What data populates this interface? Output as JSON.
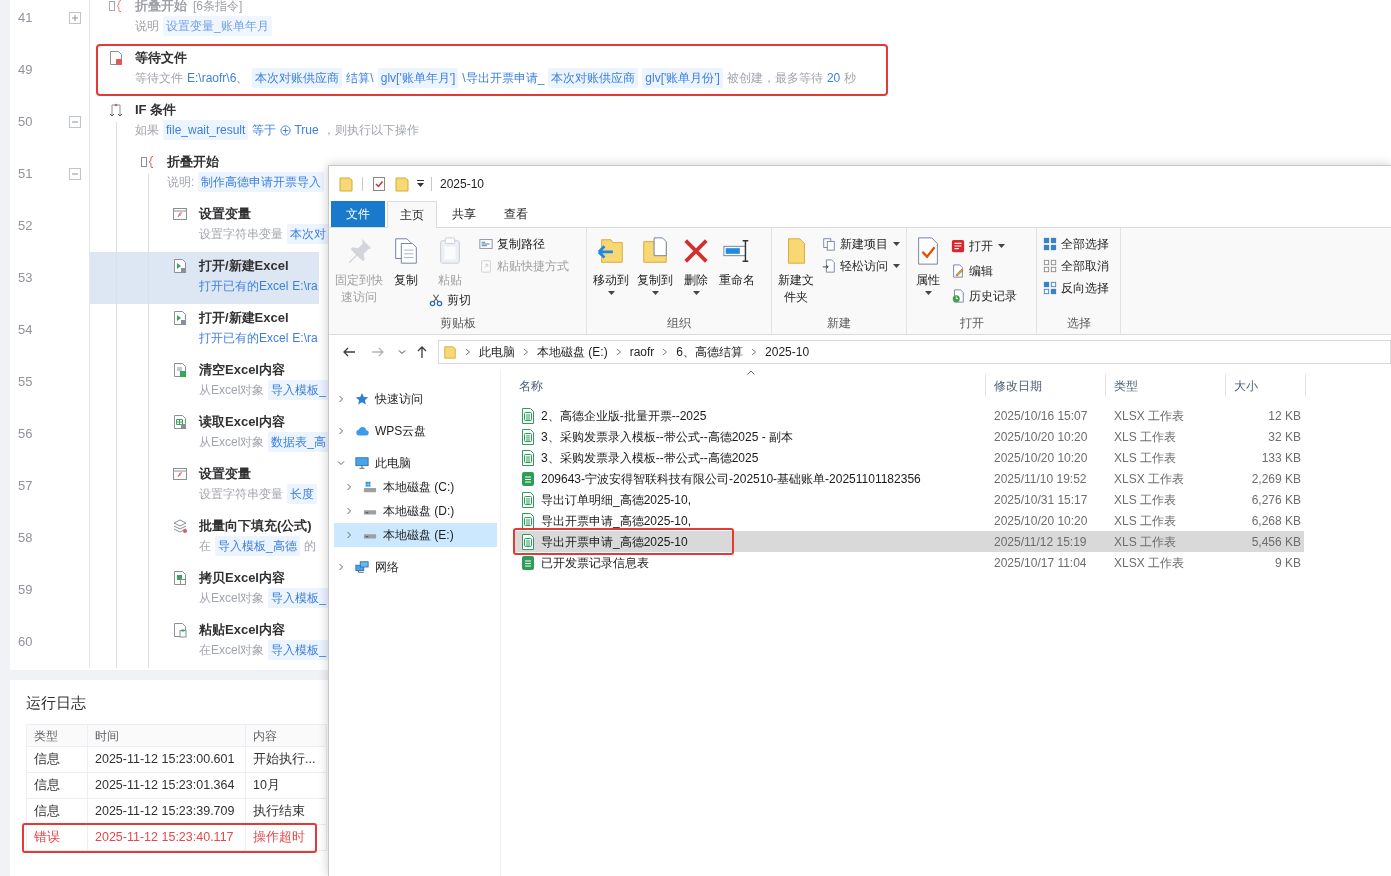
{
  "workflow": {
    "steps": [
      {
        "line": "41",
        "kind": "fold",
        "title": "折叠开始",
        "count": "[6条指令]",
        "disabled": true,
        "selected": false,
        "expanded": false,
        "description": [
          {
            "kind": "plain",
            "text": "说明"
          },
          {
            "kind": "chip",
            "text": "设置变量_账单年月"
          }
        ]
      },
      {
        "line": "49",
        "kind": "wait_file",
        "title": "等待文件",
        "disabled": false,
        "selected": false,
        "highlighted": true,
        "description": [
          {
            "kind": "plain",
            "text": "等待文件"
          },
          {
            "kind": "value",
            "text": "E:\\raofr\\6、"
          },
          {
            "kind": "chip",
            "text": "本次对账供应商"
          },
          {
            "kind": "value",
            "text": "结算\\"
          },
          {
            "kind": "chip",
            "text": "glv['账单年月']"
          },
          {
            "kind": "value",
            "text": "\\导出开票申请_"
          },
          {
            "kind": "chip",
            "text": "本次对账供应商"
          },
          {
            "kind": "chip",
            "text": "glv['账单月份']"
          },
          {
            "kind": "plain",
            "text": "被创建，最多等待"
          },
          {
            "kind": "value",
            "text": "20"
          },
          {
            "kind": "plain",
            "text": "秒"
          }
        ]
      },
      {
        "line": "50",
        "kind": "if",
        "title": "IF 条件",
        "disabled": false,
        "selected": false,
        "expanded": true,
        "description": [
          {
            "kind": "plain",
            "text": "如果"
          },
          {
            "kind": "chip",
            "text": "file_wait_result"
          },
          {
            "kind": "value",
            "text": "等于"
          },
          {
            "kind": "bool",
            "text": "True"
          },
          {
            "kind": "plain",
            "text": "，则执行以下操作"
          }
        ],
        "children": [
          {
            "line": "51",
            "kind": "fold",
            "title": "折叠开始",
            "disabled": false,
            "selected": false,
            "expanded": true,
            "description": [
              {
                "kind": "plain",
                "text": "说明:"
              },
              {
                "kind": "chip",
                "text": "制作高德申请开票导入"
              }
            ],
            "children": [
              {
                "line": "52",
                "kind": "set_variable",
                "title": "设置变量",
                "disabled": false,
                "selected": false,
                "description": [
                  {
                    "kind": "plain",
                    "text": "设置字符串变量"
                  },
                  {
                    "kind": "chip",
                    "text": "本次对"
                  }
                ]
              },
              {
                "line": "53",
                "kind": "open_excel",
                "title": "打开/新建Excel",
                "disabled": false,
                "selected": true,
                "description": [
                  {
                    "kind": "value",
                    "text": "打开已有的Excel"
                  },
                  {
                    "kind": "value",
                    "text": "E:\\ra"
                  }
                ]
              },
              {
                "line": "54",
                "kind": "open_excel",
                "title": "打开/新建Excel",
                "disabled": false,
                "selected": false,
                "description": [
                  {
                    "kind": "value",
                    "text": "打开已有的Excel"
                  },
                  {
                    "kind": "value",
                    "text": "E:\\ra"
                  }
                ]
              },
              {
                "line": "55",
                "kind": "clear_excel",
                "title": "清空Excel内容",
                "disabled": false,
                "selected": false,
                "description": [
                  {
                    "kind": "plain",
                    "text": "从Excel对象"
                  },
                  {
                    "kind": "chip",
                    "text": "导入模板_"
                  }
                ]
              },
              {
                "line": "56",
                "kind": "read_excel",
                "title": "读取Excel内容",
                "disabled": false,
                "selected": false,
                "description": [
                  {
                    "kind": "plain",
                    "text": "从Excel对象"
                  },
                  {
                    "kind": "chip",
                    "text": "数据表_高"
                  }
                ]
              },
              {
                "line": "57",
                "kind": "set_variable",
                "title": "设置变量",
                "disabled": false,
                "selected": false,
                "description": [
                  {
                    "kind": "plain",
                    "text": "设置字符串变量"
                  },
                  {
                    "kind": "chip",
                    "text": "长度"
                  }
                ]
              },
              {
                "line": "58",
                "kind": "fill_down",
                "title": "批量向下填充(公式)",
                "disabled": false,
                "selected": false,
                "description": [
                  {
                    "kind": "plain",
                    "text": "在"
                  },
                  {
                    "kind": "chip",
                    "text": "导入模板_高德"
                  },
                  {
                    "kind": "plain",
                    "text": "的"
                  }
                ]
              },
              {
                "line": "59",
                "kind": "copy_excel",
                "title": "拷贝Excel内容",
                "disabled": false,
                "selected": false,
                "description": [
                  {
                    "kind": "plain",
                    "text": "从Excel对象"
                  },
                  {
                    "kind": "chip",
                    "text": "导入模板_"
                  }
                ]
              },
              {
                "line": "60",
                "kind": "paste_excel",
                "title": "粘贴Excel内容",
                "disabled": false,
                "selected": false,
                "description": [
                  {
                    "kind": "plain",
                    "text": "在Excel对象"
                  },
                  {
                    "kind": "chip",
                    "text": "导入模板_"
                  }
                ]
              }
            ]
          }
        ]
      }
    ]
  },
  "log": {
    "title": "运行日志",
    "columns": [
      "类型",
      "时间",
      "内容"
    ],
    "rows": [
      {
        "type": "信息",
        "time": "2025-11-12 15:23:00.601",
        "content": "开始执行...",
        "error": false
      },
      {
        "type": "信息",
        "time": "2025-11-12 15:23:01.364",
        "content": "10月",
        "error": false
      },
      {
        "type": "信息",
        "time": "2025-11-12 15:23:39.709",
        "content": "执行结束",
        "error": false
      },
      {
        "type": "错误",
        "time": "2025-11-12 15:23:40.117",
        "content": "操作超时",
        "error": true,
        "highlighted": true
      }
    ]
  },
  "explorer": {
    "title": "2025-10",
    "tabs": [
      {
        "label": "文件",
        "kind": "menu",
        "selected": false
      },
      {
        "label": "主页",
        "kind": "tab",
        "selected": true
      },
      {
        "label": "共享",
        "kind": "tab",
        "selected": false
      },
      {
        "label": "查看",
        "kind": "tab",
        "selected": false
      }
    ],
    "ribbon_groups": [
      {
        "label": "剪贴板",
        "columns": [
          [
            {
              "label": "固定到快速访问",
              "kind": "large",
              "disabled": true
            }
          ],
          [
            {
              "label": "复制",
              "kind": "large",
              "disabled": false
            }
          ],
          [
            {
              "label": "粘贴",
              "kind": "large",
              "disabled": true
            },
            {
              "label": "剪切",
              "kind": "small",
              "disabled": false
            }
          ],
          [
            {
              "label": "复制路径",
              "kind": "small",
              "disabled": false
            },
            {
              "label": "粘贴快捷方式",
              "kind": "small",
              "disabled": true
            }
          ]
        ]
      },
      {
        "label": "组织",
        "columns": [
          [
            {
              "label": "移动到",
              "kind": "large",
              "disabled": false,
              "dropdown": true
            }
          ],
          [
            {
              "label": "复制到",
              "kind": "large",
              "disabled": false,
              "dropdown": true
            }
          ],
          [
            {
              "label": "删除",
              "kind": "large",
              "disabled": false,
              "dropdown": true
            }
          ],
          [
            {
              "label": "重命名",
              "kind": "large",
              "disabled": false
            }
          ]
        ]
      },
      {
        "label": "新建",
        "columns": [
          [
            {
              "label": "新建文件夹",
              "kind": "large",
              "disabled": false
            }
          ],
          [
            {
              "label": "新建项目",
              "kind": "small",
              "disabled": false,
              "dropdown": true
            },
            {
              "label": "轻松访问",
              "kind": "small",
              "disabled": false,
              "dropdown": true
            }
          ]
        ]
      },
      {
        "label": "打开",
        "columns": [
          [
            {
              "label": "属性",
              "kind": "large",
              "disabled": false,
              "dropdown": true
            }
          ],
          [
            {
              "label": "打开",
              "kind": "small",
              "disabled": false,
              "dropdown": true
            },
            {
              "label": "编辑",
              "kind": "small",
              "disabled": false
            },
            {
              "label": "历史记录",
              "kind": "small",
              "disabled": false
            }
          ]
        ]
      },
      {
        "label": "选择",
        "columns": [
          [
            {
              "label": "全部选择",
              "kind": "small",
              "disabled": false
            },
            {
              "label": "全部取消",
              "kind": "small",
              "disabled": false
            },
            {
              "label": "反向选择",
              "kind": "small",
              "disabled": false
            }
          ]
        ]
      }
    ],
    "navigation_buttons": [
      {
        "kind": "back",
        "disabled": false
      },
      {
        "kind": "forward",
        "disabled": true
      },
      {
        "kind": "recent",
        "disabled": false
      },
      {
        "kind": "up",
        "disabled": false
      }
    ],
    "address": {
      "breadcrumbs": [
        "此电脑",
        "本地磁盘 (E:)",
        "raofr",
        "6、高德结算",
        "2025-10"
      ]
    },
    "navigation": [
      {
        "label": "快速访问",
        "kind": "star",
        "expanded": false,
        "selected": false
      },
      {
        "label": "WPS云盘",
        "kind": "cloud",
        "expanded": false,
        "selected": false
      },
      {
        "label": "此电脑",
        "kind": "computer",
        "expanded": true,
        "selected": false,
        "children": [
          {
            "label": "本地磁盘 (C:)",
            "kind": "system_drive",
            "expanded": false,
            "selected": false
          },
          {
            "label": "本地磁盘 (D:)",
            "kind": "drive",
            "expanded": false,
            "selected": false
          },
          {
            "label": "本地磁盘 (E:)",
            "kind": "drive",
            "expanded": false,
            "selected": true
          }
        ]
      },
      {
        "label": "网络",
        "kind": "network",
        "expanded": false,
        "selected": false
      }
    ],
    "files": {
      "columns": [
        {
          "label": "名称",
          "sorted": true
        },
        {
          "label": "修改日期",
          "sorted": false
        },
        {
          "label": "类型",
          "sorted": false
        },
        {
          "label": "大小",
          "sorted": false
        }
      ],
      "rows": [
        {
          "name": "2、高德企业版-批量开票--2025",
          "modified": "2025/10/16 15:07",
          "type": "XLSX 工作表",
          "size": "12 KB",
          "kind": "outline",
          "selected": false
        },
        {
          "name": "3、采购发票录入模板--带公式--高德2025 - 副本",
          "modified": "2025/10/20 10:20",
          "type": "XLS 工作表",
          "size": "32 KB",
          "kind": "outline",
          "selected": false
        },
        {
          "name": "3、采购发票录入模板--带公式--高德2025",
          "modified": "2025/10/20 10:20",
          "type": "XLS 工作表",
          "size": "133 KB",
          "kind": "outline",
          "selected": false
        },
        {
          "name": "209643-宁波安得智联科技有限公司-202510-基础账单-20251101182356",
          "modified": "2025/11/10 19:52",
          "type": "XLSX 工作表",
          "size": "2,269 KB",
          "kind": "solid",
          "selected": false
        },
        {
          "name": "导出订单明细_高德2025-10,",
          "modified": "2025/10/31 15:17",
          "type": "XLS 工作表",
          "size": "6,276 KB",
          "kind": "outline",
          "selected": false
        },
        {
          "name": "导出开票申请_高德2025-10,",
          "modified": "2025/10/20 10:20",
          "type": "XLS 工作表",
          "size": "6,268 KB",
          "kind": "outline",
          "selected": false
        },
        {
          "name": "导出开票申请_高德2025-10",
          "modified": "2025/11/12 15:19",
          "type": "XLS 工作表",
          "size": "5,456 KB",
          "kind": "outline",
          "selected": true,
          "highlighted": true
        },
        {
          "name": "已开发票记录信息表",
          "modified": "2025/10/17 11:04",
          "type": "XLSX 工作表",
          "size": "9 KB",
          "kind": "solid",
          "selected": false
        }
      ]
    }
  }
}
